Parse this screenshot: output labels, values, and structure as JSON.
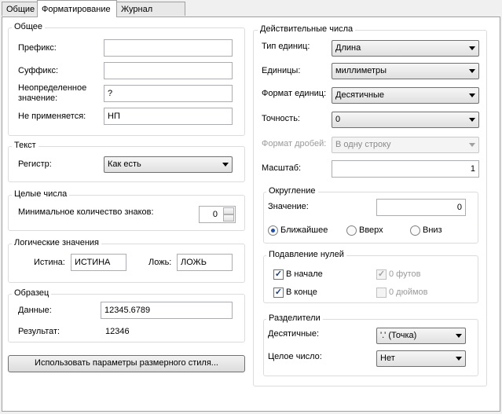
{
  "tabs": [
    "Общие",
    "Форматирование",
    "Журнал версий"
  ],
  "general": {
    "title": "Общее",
    "prefix_label": "Префикс:",
    "prefix_value": "",
    "suffix_label": "Суффикс:",
    "suffix_value": "",
    "undefined_label_1": "Неопределенное",
    "undefined_label_2": "значение:",
    "undefined_value": "?",
    "na_label": "Не применяется:",
    "na_value": "НП"
  },
  "text": {
    "title": "Текст",
    "case_label": "Регистр:",
    "case_value": "Как есть"
  },
  "integers": {
    "title": "Целые числа",
    "min_digits_label": "Минимальное количество знаков:",
    "min_digits_value": "0"
  },
  "boolean": {
    "title": "Логические значения",
    "true_label": "Истина:",
    "true_value": "ИСТИНА",
    "false_label": "Ложь:",
    "false_value": "ЛОЖЬ"
  },
  "sample": {
    "title": "Образец",
    "data_label": "Данные:",
    "data_value": "12345.6789",
    "result_label": "Результат:",
    "result_value": "12346"
  },
  "use_style_button": "Использовать параметры размерного стиля...",
  "real": {
    "title": "Действительные числа",
    "unit_type_label": "Тип единиц:",
    "unit_type_value": "Длина",
    "units_label": "Единицы:",
    "units_value": "миллиметры",
    "unit_format_label": "Формат единиц:",
    "unit_format_value": "Десятичные",
    "precision_label": "Точность:",
    "precision_value": "0",
    "fraction_label": "Формат дробей:",
    "fraction_value": "В одну строку",
    "scale_label": "Масштаб:",
    "scale_value": "1"
  },
  "rounding": {
    "title": "Округление",
    "value_label": "Значение:",
    "value": "0",
    "nearest": "Ближайшее",
    "up": "Вверх",
    "down": "Вниз"
  },
  "zeros": {
    "title": "Подавление нулей",
    "leading": "В начале",
    "trailing": "В конце",
    "feet": "0 футов",
    "inches": "0 дюймов"
  },
  "separators": {
    "title": "Разделители",
    "decimal_label": "Десятичные:",
    "decimal_value": "'.' (Точка)",
    "integer_label": "Целое число:",
    "integer_value": "Нет"
  }
}
